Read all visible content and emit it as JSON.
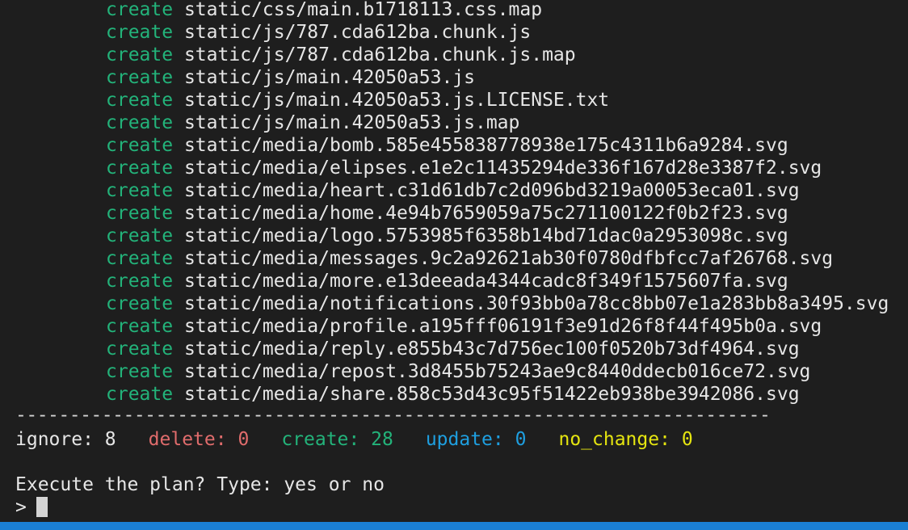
{
  "colors": {
    "background": "#1e1e1e",
    "create": "#23b37a",
    "delete": "#e06c6c",
    "update": "#1e9fe0",
    "no_change": "#e5e510",
    "ignore": "#e6e6e6",
    "status_bar": "#1a7fd4",
    "cursor": "#d4d4d4"
  },
  "log": [
    {
      "action": "create",
      "path": "static/css/main.b1718113.css.map"
    },
    {
      "action": "create",
      "path": "static/js/787.cda612ba.chunk.js"
    },
    {
      "action": "create",
      "path": "static/js/787.cda612ba.chunk.js.map"
    },
    {
      "action": "create",
      "path": "static/js/main.42050a53.js"
    },
    {
      "action": "create",
      "path": "static/js/main.42050a53.js.LICENSE.txt"
    },
    {
      "action": "create",
      "path": "static/js/main.42050a53.js.map"
    },
    {
      "action": "create",
      "path": "static/media/bomb.585e455838778938e175c4311b6a9284.svg"
    },
    {
      "action": "create",
      "path": "static/media/elipses.e1e2c11435294de336f167d28e3387f2.svg"
    },
    {
      "action": "create",
      "path": "static/media/heart.c31d61db7c2d096bd3219a00053eca01.svg"
    },
    {
      "action": "create",
      "path": "static/media/home.4e94b7659059a75c271100122f0b2f23.svg"
    },
    {
      "action": "create",
      "path": "static/media/logo.5753985f6358b14bd71dac0a2953098c.svg"
    },
    {
      "action": "create",
      "path": "static/media/messages.9c2a92621ab30f0780dfbfcc7af26768.svg"
    },
    {
      "action": "create",
      "path": "static/media/more.e13deeada4344cadc8f349f1575607fa.svg"
    },
    {
      "action": "create",
      "path": "static/media/notifications.30f93bb0a78cc8bb07e1a283bb8a3495.svg"
    },
    {
      "action": "create",
      "path": "static/media/profile.a195fff06191f3e91d26f8f44f495b0a.svg"
    },
    {
      "action": "create",
      "path": "static/media/reply.e855b43c7d756ec100f0520b73df4964.svg"
    },
    {
      "action": "create",
      "path": "static/media/repost.3d8455b75243ae9c8440ddecb016ce72.svg"
    },
    {
      "action": "create",
      "path": "static/media/share.858c53d43c95f51422eb938be3942086.svg"
    }
  ],
  "separator": "----------------------------------------------------------------------",
  "summary": [
    {
      "label": "ignore:",
      "value": "8",
      "color_key": "ignore"
    },
    {
      "label": "delete:",
      "value": "0",
      "color_key": "delete"
    },
    {
      "label": "create:",
      "value": "28",
      "color_key": "create"
    },
    {
      "label": "update:",
      "value": "0",
      "color_key": "update"
    },
    {
      "label": "no_change:",
      "value": "0",
      "color_key": "no_change"
    }
  ],
  "prompt": {
    "question": "Execute the plan? Type: yes or no",
    "input_marker": ">"
  }
}
